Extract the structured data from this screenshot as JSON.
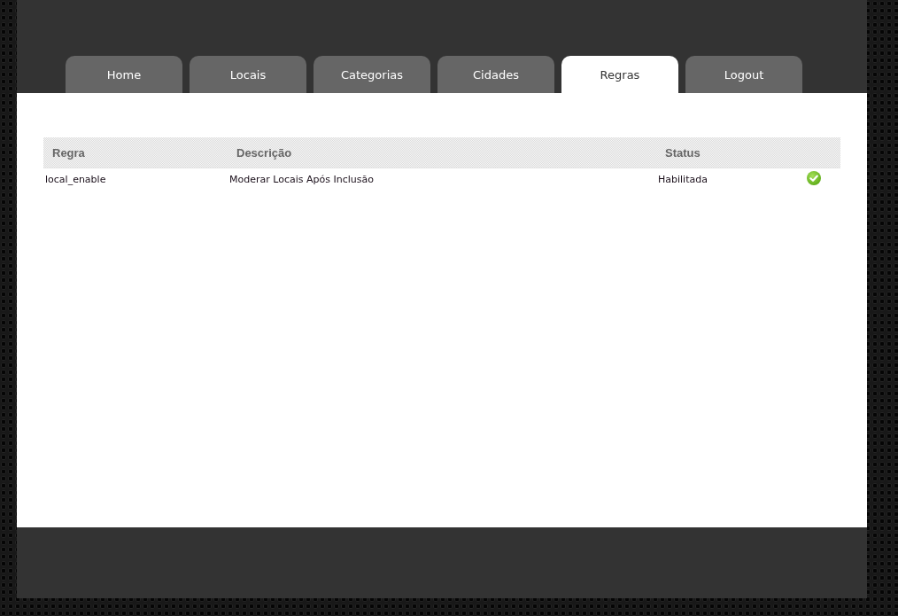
{
  "tabs": [
    {
      "label": "Home",
      "selected": false
    },
    {
      "label": "Locais",
      "selected": false
    },
    {
      "label": "Categorias",
      "selected": false
    },
    {
      "label": "Cidades",
      "selected": false
    },
    {
      "label": "Regras",
      "selected": true
    },
    {
      "label": "Logout",
      "selected": false
    }
  ],
  "table": {
    "columns": [
      "Regra",
      "Descrição",
      "Status"
    ],
    "rows": [
      {
        "cells": [
          "local_enable",
          "Moderar Locais Após Inclusão",
          "Habilitada"
        ],
        "enabled": true
      }
    ]
  }
}
